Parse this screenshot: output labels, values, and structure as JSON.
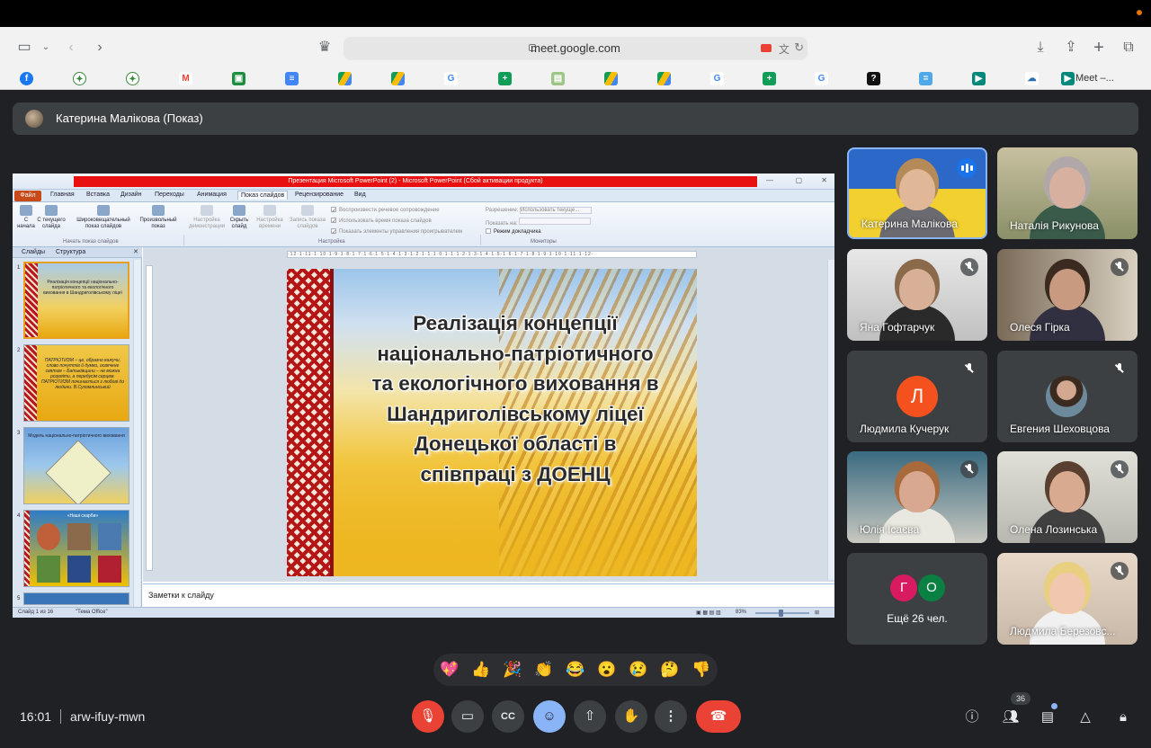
{
  "browser": {
    "url": "meet.google.com",
    "last_tab_label": "Meet –..."
  },
  "presenter": {
    "label": "Катерина Малікова (Показ)"
  },
  "powerpoint": {
    "window_title": "Презентация Microsoft PowerPoint (2) - Microsoft PowerPoint (Сбой активации продукта)",
    "menu": [
      "Файл",
      "Главная",
      "Вставка",
      "Дизайн",
      "Переходы",
      "Анимация",
      "Показ слайдов",
      "Рецензирование",
      "Вид"
    ],
    "ribbon": {
      "from_start": "С начала",
      "from_current": "С текущего слайда",
      "broadcast": "Широковещательный показ слайдов",
      "custom": "Произвольный показ",
      "group_start": "Начать показ слайдов",
      "setup": "Настройка демонстрации",
      "hide": "Скрыть слайд",
      "rehearse": "Настройка времени",
      "record": "Запись показа слайдов",
      "chk_narration": "Воспроизвести речевое сопровождение",
      "chk_timings": "Использовать время показа слайдов",
      "chk_controls": "Показать элементы управления проигрывателем",
      "group_setup": "Настройка",
      "resolution_label": "Разрешение:",
      "resolution_value": "Использовать текуще...",
      "show_on_label": "Показать на:",
      "presenter_view": "Режим докладчика",
      "group_monitors": "Мониторы"
    },
    "tabs": [
      "Слайды",
      "Структура"
    ],
    "thumbnails": [
      {
        "num": "1",
        "text": "Реалізація концепції національно-патріотичного та екологічного виховання в Шандриголівському ліцеї"
      },
      {
        "num": "2",
        "text": "ПАТРІОТИЗМ – це, образно кажучи, слово почуттів й думки, освячене святим – Батьківщини – не можна розуміти, а передусім серцем. ПАТРІОТИЗМ починається з любові до людини. В.Сухомлинський"
      },
      {
        "num": "3",
        "text": "Модель національно-патріотичного виховання"
      },
      {
        "num": "4",
        "text": "«Наші скарби»"
      },
      {
        "num": "5",
        "text": ""
      }
    ],
    "slide_title_lines": [
      "Реалізація концепції",
      "національно-патріотичного",
      "та екологічного виховання в",
      "Шандриголівському ліцеї",
      "Донецької області в",
      "співпраці з ДОЕНЦ"
    ],
    "ruler_text": "·12·1·11·1·10·1·9·1·8·1·7·1·6·1·5·1·4·1·3·1·2·1·1·1·0·1·1·1·2·1·3·1·4·1·5·1·6·1·7·1·8·1·9·1·10·1·11·1·12·",
    "notes_placeholder": "Заметки к слайду",
    "status_slide": "Слайд 1 из 16",
    "status_theme": "\"Тема Office\"",
    "zoom": "83%"
  },
  "participants": [
    {
      "name": "Катерина Малікова",
      "speaking": true
    },
    {
      "name": "Наталія Рикунова",
      "muted": false
    },
    {
      "name": "Яна Гофтарчук",
      "muted": true
    },
    {
      "name": "Олеся Гірка",
      "muted": true
    },
    {
      "name": "Людмила Кучерук",
      "muted": true,
      "initial": "Л",
      "color": "#f4511e"
    },
    {
      "name": "Евгения Шеховцова",
      "muted": true
    },
    {
      "name": "Юлія Ісаєва",
      "muted": true
    },
    {
      "name": "Олена Лозинська",
      "muted": true
    },
    {
      "name": "Людмила Березовс...",
      "muted": true
    }
  ],
  "more_tile": {
    "initials": [
      {
        "letter": "Г",
        "color": "#d81b60"
      },
      {
        "letter": "О",
        "color": "#0b8043"
      }
    ],
    "label": "Ещё 26 чел."
  },
  "reactions": [
    "💖",
    "👍",
    "🎉",
    "👏",
    "😂",
    "😮",
    "😢",
    "🤔",
    "👎"
  ],
  "meeting": {
    "time": "16:01",
    "code": "arw-ifuy-mwn",
    "participant_count": "36"
  },
  "colors": {
    "meet_bg": "#202124",
    "hangup": "#ea4335",
    "accent": "#8ab4f8"
  }
}
